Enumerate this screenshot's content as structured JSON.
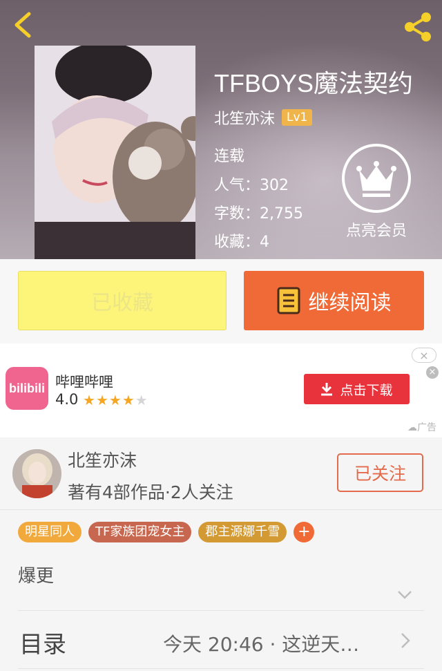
{
  "header": {
    "book_title": "TFBOYS魔法契约",
    "author": "北笙亦沫",
    "level": "Lv1",
    "status": "连载",
    "popularity": "人气：302",
    "word_count": "字数：2,755",
    "favorites": "收藏：4",
    "vip_label": "点亮会员"
  },
  "actions": {
    "collected_label": "已收藏",
    "read_label": "继续阅读"
  },
  "ad": {
    "app_icon_text": "bilibili",
    "app_name": "哔哩哔哩",
    "rating": "4.0",
    "stars": 4,
    "download_label": "点击下载",
    "ad_label": "广告",
    "close_glyph": "×"
  },
  "author_card": {
    "name": "北笙亦沫",
    "works_info": "著有4部作品·2人关注",
    "follow_label": "已关注"
  },
  "tags": [
    {
      "label": "明星同人",
      "color": "#f2a93b"
    },
    {
      "label": "TF家族团宠女主",
      "color": "#c8674f"
    },
    {
      "label": "郡主源娜千雪",
      "color": "#d39a34"
    }
  ],
  "tag_add_glyph": "+",
  "description": "爆更",
  "catalog": {
    "label": "目录",
    "latest_update": "今天 20:46 · 这逆天…"
  },
  "colors": {
    "accent": "#f06a37",
    "collected_bg": "#fcf57a",
    "download": "#e8323c",
    "follow": "#e36a4a"
  },
  "icons": [
    "back-arrow-icon",
    "share-icon",
    "crown-icon",
    "book-icon",
    "download-icon",
    "chevron-down-icon",
    "chevron-right-icon"
  ]
}
